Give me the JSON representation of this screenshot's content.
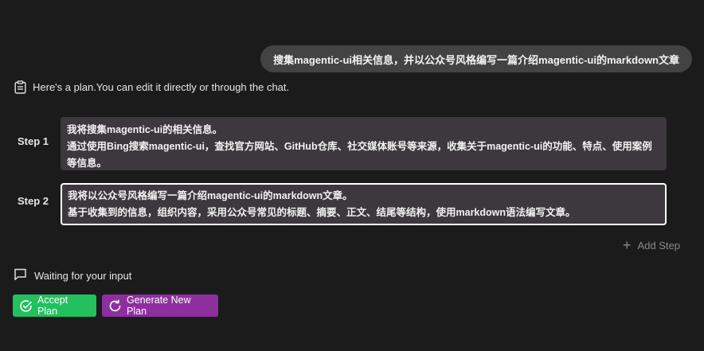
{
  "user_message": "搜集magentic-ui相关信息，并以公众号风格编写一篇介绍magentic-ui的markdown文章",
  "plan": {
    "header_icon": "clipboard-icon",
    "header_text": "Here's a plan.You can edit it directly or through the chat.",
    "steps": [
      {
        "label": "Step 1",
        "title": "我将搜集magentic-ui的相关信息。",
        "details": "通过使用Bing搜索magentic-ui，查找官方网站、GitHub仓库、社交媒体账号等来源，收集关于magentic-ui的功能、特点、使用案例等信息。"
      },
      {
        "label": "Step 2",
        "title": "我将以公众号风格编写一篇介绍magentic-ui的markdown文章。",
        "details": "基于收集到的信息，组织内容，采用公众号常见的标题、摘要、正文、结尾等结构，使用markdown语法编写文章。"
      }
    ],
    "add_step_label": "Add Step"
  },
  "status": {
    "icon": "chat-bubble-icon",
    "text": "Waiting for your input"
  },
  "actions": {
    "accept_label": "Accept Plan",
    "accept_icon": "check-circle-icon",
    "accept_color": "#22c05e",
    "generate_label": "Generate New Plan",
    "generate_icon": "refresh-icon",
    "generate_color": "#8e2fa0"
  }
}
